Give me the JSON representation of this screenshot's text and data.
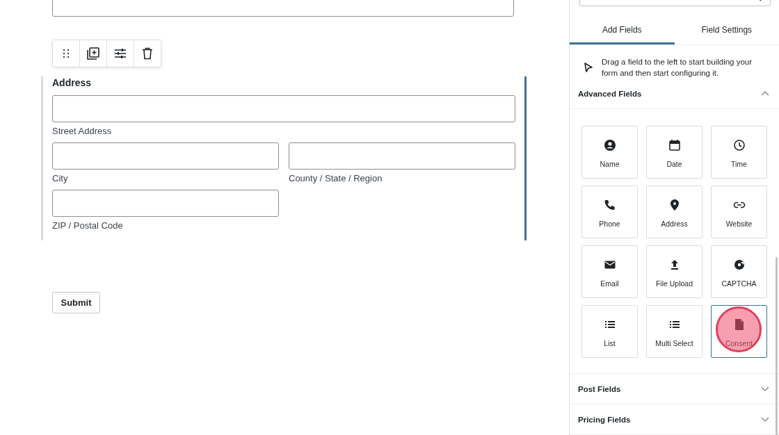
{
  "form": {
    "address": {
      "label": "Address",
      "fields": [
        {
          "sublabel": "Street Address"
        },
        {
          "sublabel": "City"
        },
        {
          "sublabel": "County / State / Region"
        },
        {
          "sublabel": "ZIP / Postal Code"
        }
      ]
    },
    "submit": "Submit"
  },
  "sidebar": {
    "tabs": [
      {
        "label": "Add Fields",
        "selected": true
      },
      {
        "label": "Field Settings",
        "selected": false
      }
    ],
    "hint": "Drag a field to the left to start building your form and then start configuring it.",
    "sections": [
      {
        "title": "Advanced Fields",
        "expanded": true,
        "tiles": [
          {
            "label": "Name",
            "selected": false
          },
          {
            "label": "Date",
            "selected": false
          },
          {
            "label": "Time",
            "selected": false
          },
          {
            "label": "Phone",
            "selected": false
          },
          {
            "label": "Address",
            "selected": false
          },
          {
            "label": "Website",
            "selected": false
          },
          {
            "label": "Email",
            "selected": false
          },
          {
            "label": "File Upload",
            "selected": false
          },
          {
            "label": "CAPTCHA",
            "selected": false
          },
          {
            "label": "List",
            "selected": false
          },
          {
            "label": "Multi Select",
            "selected": false
          },
          {
            "label": "Consent",
            "selected": true
          }
        ]
      },
      {
        "title": "Post Fields",
        "expanded": false
      },
      {
        "title": "Pricing Fields",
        "expanded": false
      }
    ]
  }
}
